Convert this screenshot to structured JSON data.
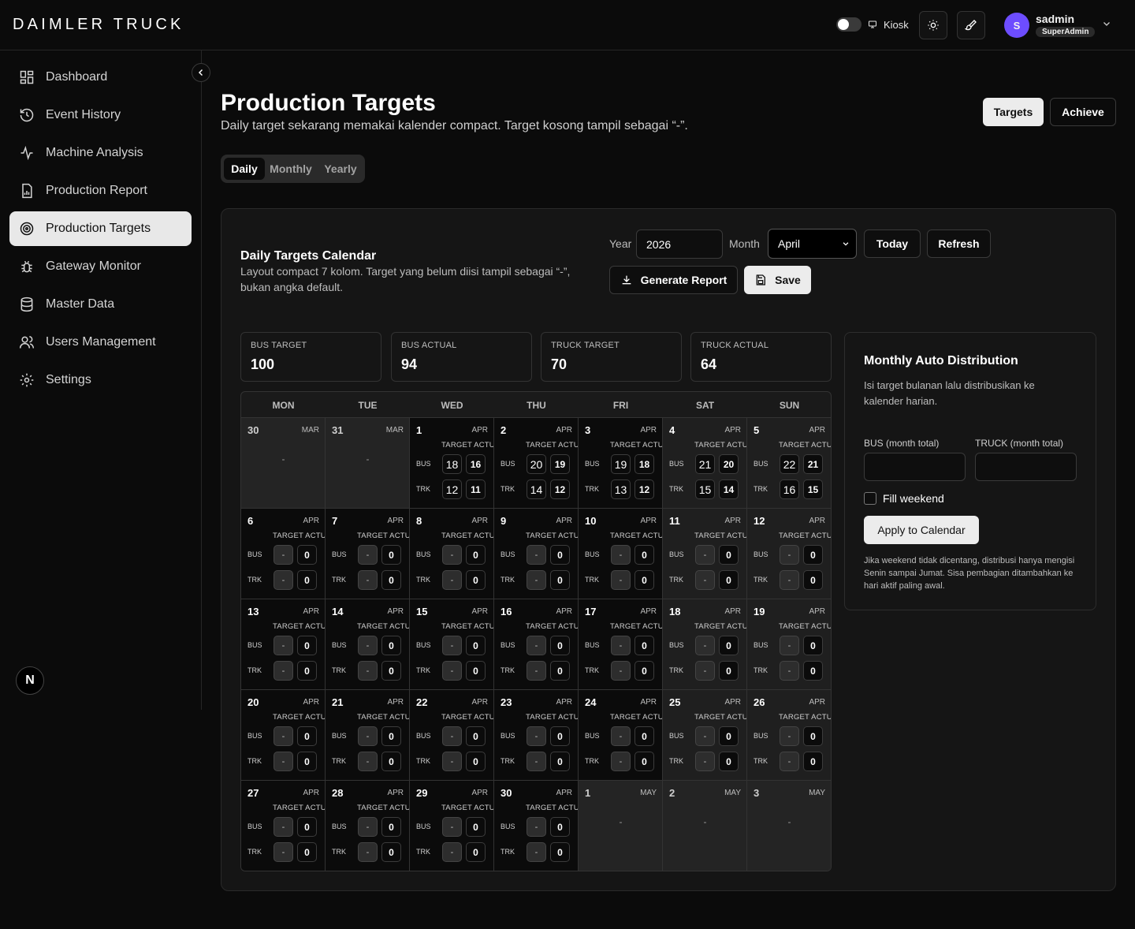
{
  "brand": "DAIMLER TRUCK",
  "topbar": {
    "kiosk_label": "Kiosk",
    "user_name": "sadmin",
    "user_role": "SuperAdmin",
    "avatar_initial": "S"
  },
  "sidebar": {
    "items": [
      {
        "label": "Dashboard",
        "icon": "dashboard-icon",
        "active": false
      },
      {
        "label": "Event History",
        "icon": "history-icon",
        "active": false
      },
      {
        "label": "Machine Analysis",
        "icon": "activity-icon",
        "active": false
      },
      {
        "label": "Production Report",
        "icon": "report-icon",
        "active": false
      },
      {
        "label": "Production Targets",
        "icon": "target-icon",
        "active": true
      },
      {
        "label": "Gateway Monitor",
        "icon": "bug-icon",
        "active": false
      },
      {
        "label": "Master Data",
        "icon": "database-icon",
        "active": false
      },
      {
        "label": "Users Management",
        "icon": "users-icon",
        "active": false
      },
      {
        "label": "Settings",
        "icon": "gear-icon",
        "active": false
      }
    ],
    "badge": "N"
  },
  "page": {
    "title": "Production Targets",
    "subtitle": "Daily target sekarang memakai kalender compact. Target kosong tampil sebagai “-”.",
    "header_buttons": {
      "targets": "Targets",
      "achieve": "Achieve"
    },
    "tabs": [
      "Daily",
      "Monthly",
      "Yearly"
    ],
    "active_tab": "Daily"
  },
  "calendar_card": {
    "title": "Daily Targets Calendar",
    "subtitle": "Layout compact 7 kolom. Target yang belum diisi tampil sebagai “-”, bukan angka default.",
    "year_label": "Year",
    "year_value": "2026",
    "month_label": "Month",
    "month_value": "April",
    "today_button": "Today",
    "refresh_button": "Refresh",
    "generate_button": "Generate Report",
    "save_button": "Save"
  },
  "stats": [
    {
      "label": "BUS TARGET",
      "value": "100"
    },
    {
      "label": "BUS ACTUAL",
      "value": "94"
    },
    {
      "label": "TRUCK TARGET",
      "value": "70"
    },
    {
      "label": "TRUCK ACTUAL",
      "value": "64"
    }
  ],
  "calendar": {
    "weekdays": [
      "MON",
      "TUE",
      "WED",
      "THU",
      "FRI",
      "SAT",
      "SUN"
    ],
    "target_header": "TARGET ACTUAL",
    "bus_label": "BUS",
    "truck_label": "TRK",
    "empty_mark": "-",
    "weeks": [
      [
        {
          "day": "30",
          "mon": "MAR",
          "out": true
        },
        {
          "day": "31",
          "mon": "MAR",
          "out": true
        },
        {
          "day": "1",
          "mon": "APR",
          "bus_t": "18",
          "bus_a": "16",
          "trk_t": "12",
          "trk_a": "11"
        },
        {
          "day": "2",
          "mon": "APR",
          "bus_t": "20",
          "bus_a": "19",
          "trk_t": "14",
          "trk_a": "12"
        },
        {
          "day": "3",
          "mon": "APR",
          "bus_t": "19",
          "bus_a": "18",
          "trk_t": "13",
          "trk_a": "12"
        },
        {
          "day": "4",
          "mon": "APR",
          "bus_t": "21",
          "bus_a": "20",
          "trk_t": "15",
          "trk_a": "14"
        },
        {
          "day": "5",
          "mon": "APR",
          "bus_t": "22",
          "bus_a": "21",
          "trk_t": "16",
          "trk_a": "15"
        }
      ],
      [
        {
          "day": "6",
          "mon": "APR",
          "bus_t": "-",
          "bus_a": "0",
          "trk_t": "-",
          "trk_a": "0"
        },
        {
          "day": "7",
          "mon": "APR",
          "bus_t": "-",
          "bus_a": "0",
          "trk_t": "-",
          "trk_a": "0"
        },
        {
          "day": "8",
          "mon": "APR",
          "bus_t": "-",
          "bus_a": "0",
          "trk_t": "-",
          "trk_a": "0"
        },
        {
          "day": "9",
          "mon": "APR",
          "bus_t": "-",
          "bus_a": "0",
          "trk_t": "-",
          "trk_a": "0"
        },
        {
          "day": "10",
          "mon": "APR",
          "bus_t": "-",
          "bus_a": "0",
          "trk_t": "-",
          "trk_a": "0"
        },
        {
          "day": "11",
          "mon": "APR",
          "bus_t": "-",
          "bus_a": "0",
          "trk_t": "-",
          "trk_a": "0"
        },
        {
          "day": "12",
          "mon": "APR",
          "bus_t": "-",
          "bus_a": "0",
          "trk_t": "-",
          "trk_a": "0"
        }
      ],
      [
        {
          "day": "13",
          "mon": "APR",
          "bus_t": "-",
          "bus_a": "0",
          "trk_t": "-",
          "trk_a": "0"
        },
        {
          "day": "14",
          "mon": "APR",
          "bus_t": "-",
          "bus_a": "0",
          "trk_t": "-",
          "trk_a": "0"
        },
        {
          "day": "15",
          "mon": "APR",
          "bus_t": "-",
          "bus_a": "0",
          "trk_t": "-",
          "trk_a": "0"
        },
        {
          "day": "16",
          "mon": "APR",
          "bus_t": "-",
          "bus_a": "0",
          "trk_t": "-",
          "trk_a": "0"
        },
        {
          "day": "17",
          "mon": "APR",
          "bus_t": "-",
          "bus_a": "0",
          "trk_t": "-",
          "trk_a": "0"
        },
        {
          "day": "18",
          "mon": "APR",
          "bus_t": "-",
          "bus_a": "0",
          "trk_t": "-",
          "trk_a": "0"
        },
        {
          "day": "19",
          "mon": "APR",
          "bus_t": "-",
          "bus_a": "0",
          "trk_t": "-",
          "trk_a": "0"
        }
      ],
      [
        {
          "day": "20",
          "mon": "APR",
          "bus_t": "-",
          "bus_a": "0",
          "trk_t": "-",
          "trk_a": "0"
        },
        {
          "day": "21",
          "mon": "APR",
          "bus_t": "-",
          "bus_a": "0",
          "trk_t": "-",
          "trk_a": "0"
        },
        {
          "day": "22",
          "mon": "APR",
          "bus_t": "-",
          "bus_a": "0",
          "trk_t": "-",
          "trk_a": "0"
        },
        {
          "day": "23",
          "mon": "APR",
          "bus_t": "-",
          "bus_a": "0",
          "trk_t": "-",
          "trk_a": "0"
        },
        {
          "day": "24",
          "mon": "APR",
          "bus_t": "-",
          "bus_a": "0",
          "trk_t": "-",
          "trk_a": "0"
        },
        {
          "day": "25",
          "mon": "APR",
          "bus_t": "-",
          "bus_a": "0",
          "trk_t": "-",
          "trk_a": "0"
        },
        {
          "day": "26",
          "mon": "APR",
          "bus_t": "-",
          "bus_a": "0",
          "trk_t": "-",
          "trk_a": "0"
        }
      ],
      [
        {
          "day": "27",
          "mon": "APR",
          "bus_t": "-",
          "bus_a": "0",
          "trk_t": "-",
          "trk_a": "0"
        },
        {
          "day": "28",
          "mon": "APR",
          "bus_t": "-",
          "bus_a": "0",
          "trk_t": "-",
          "trk_a": "0"
        },
        {
          "day": "29",
          "mon": "APR",
          "bus_t": "-",
          "bus_a": "0",
          "trk_t": "-",
          "trk_a": "0"
        },
        {
          "day": "30",
          "mon": "APR",
          "bus_t": "-",
          "bus_a": "0",
          "trk_t": "-",
          "trk_a": "0"
        },
        {
          "day": "1",
          "mon": "MAY",
          "out": true
        },
        {
          "day": "2",
          "mon": "MAY",
          "out": true
        },
        {
          "day": "3",
          "mon": "MAY",
          "out": true
        }
      ]
    ]
  },
  "distribution": {
    "title": "Monthly Auto Distribution",
    "subtitle": "Isi target bulanan lalu distribusikan ke kalender harian.",
    "bus_label": "BUS (month total)",
    "truck_label": "TRUCK (month total)",
    "fill_weekend": "Fill weekend",
    "apply_button": "Apply to Calendar",
    "note": "Jika weekend tidak dicentang, distribusi hanya mengisi Senin sampai Jumat. Sisa pembagian ditambahkan ke hari aktif paling awal."
  },
  "colors": {
    "accent": "#6d4dff",
    "active_nav_bg": "#e8e8e8",
    "page_bg": "#0b0b0b"
  }
}
